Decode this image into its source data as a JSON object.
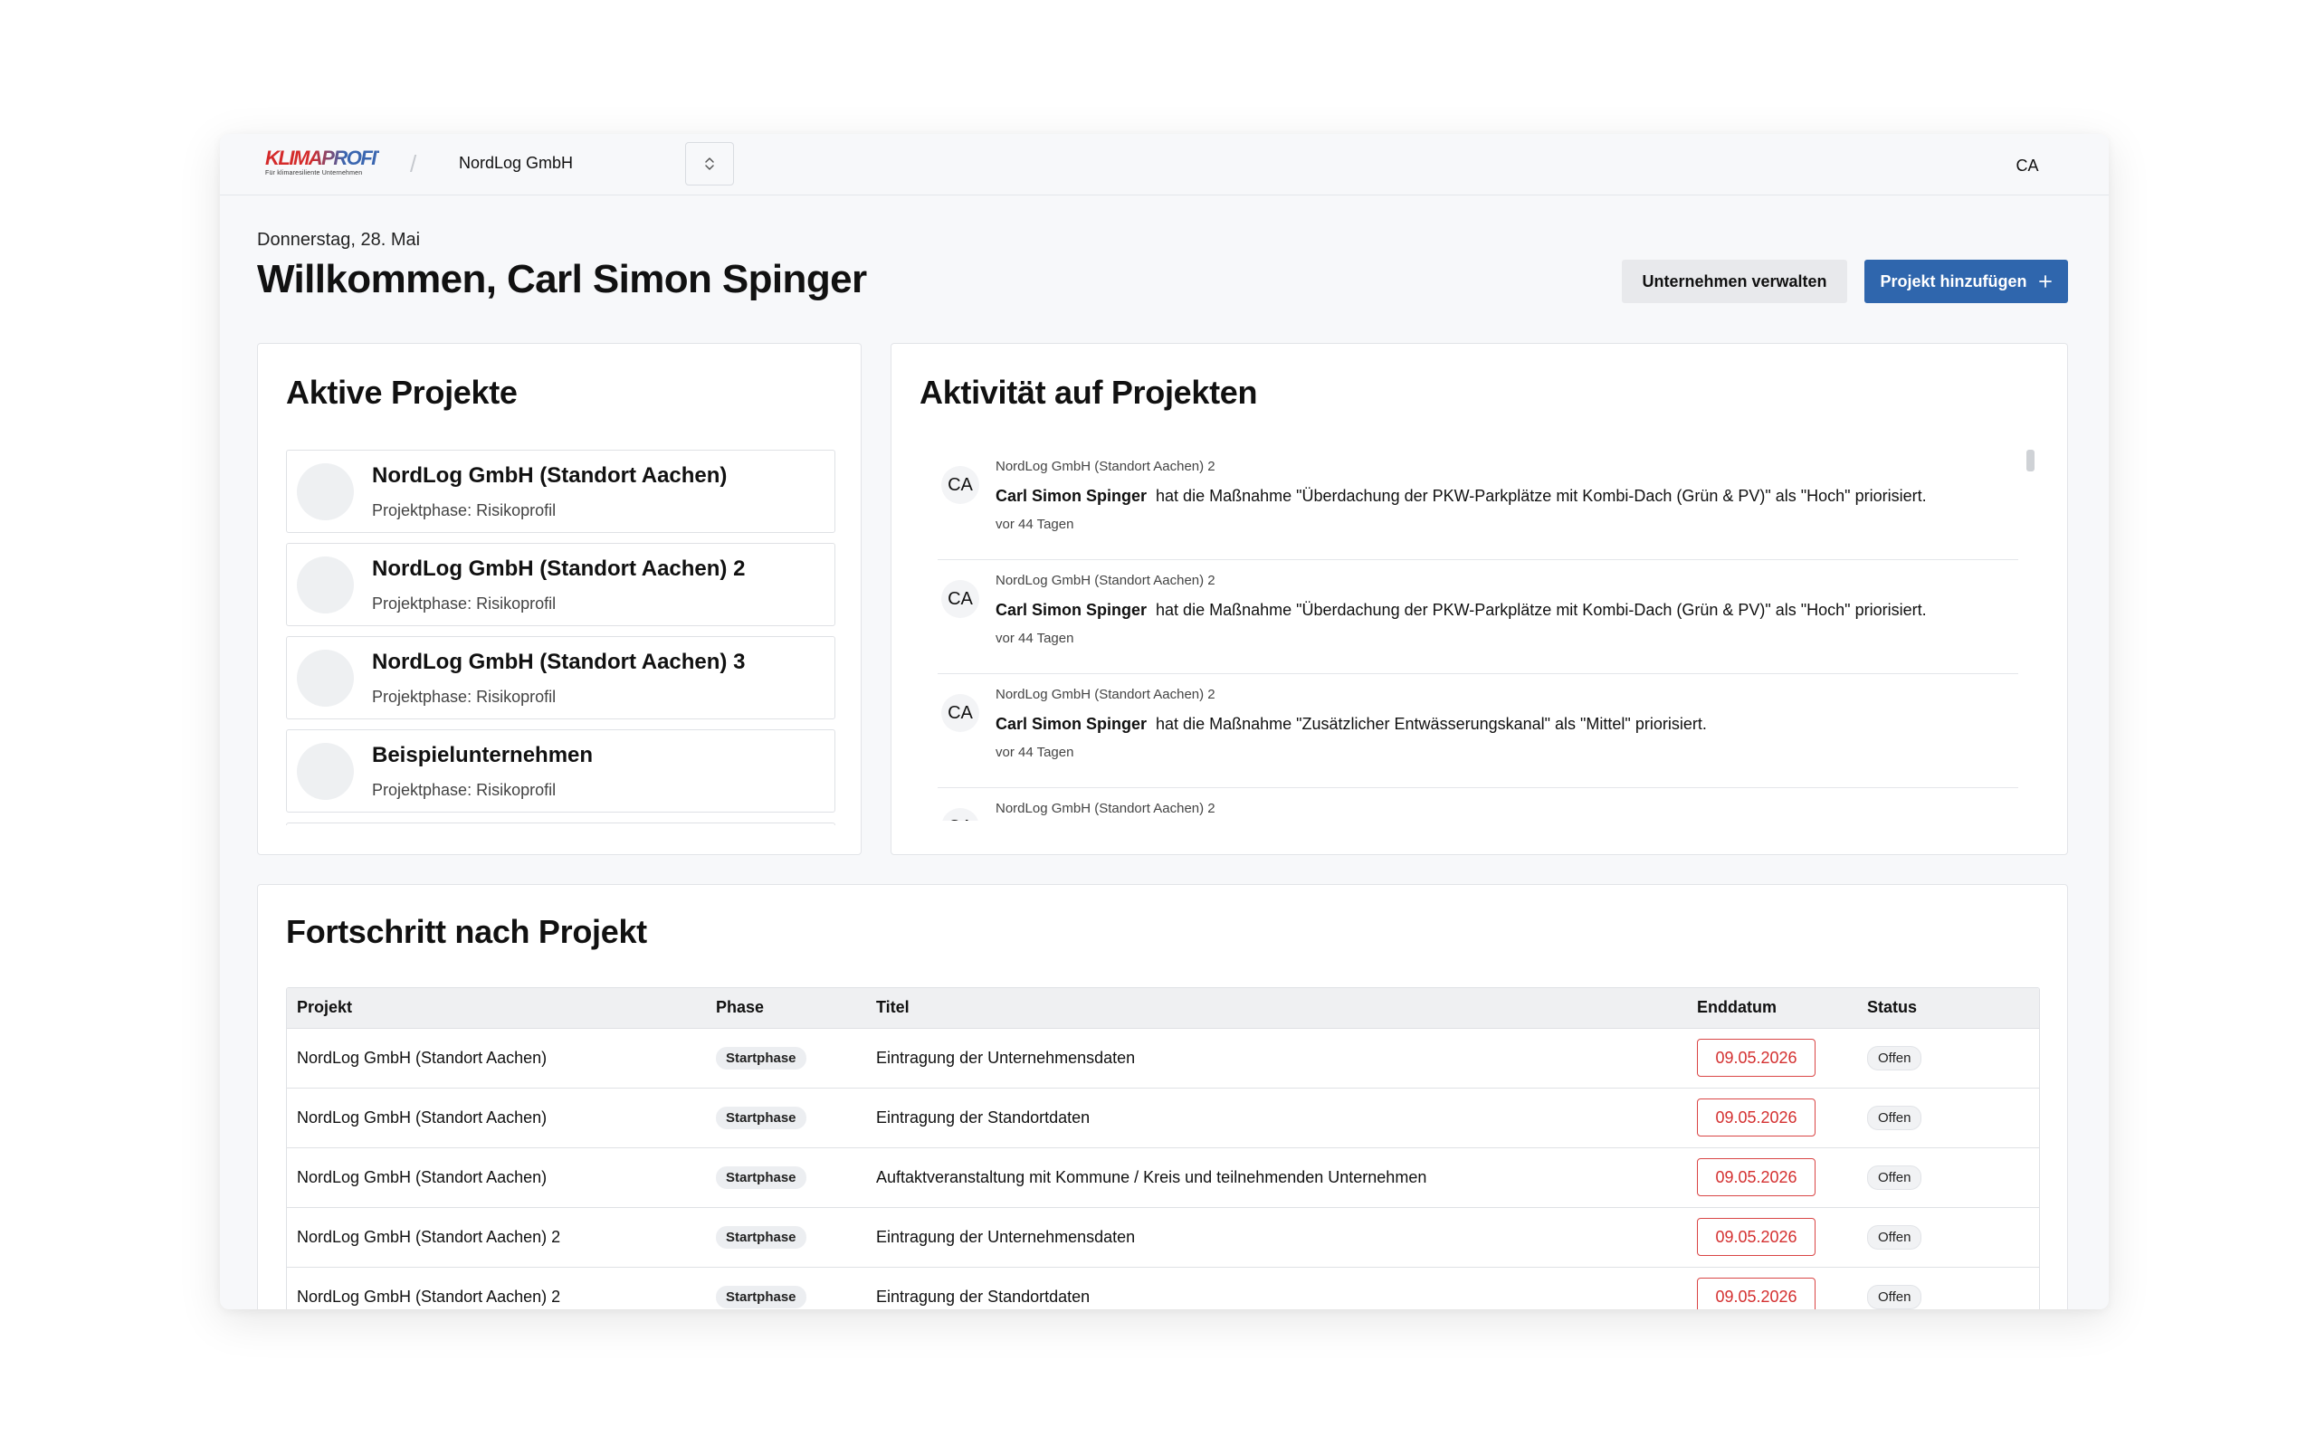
{
  "topbar": {
    "logo_text": "KLIMAPROFIT",
    "logo_tagline": "Für klimaresiliente Unternehmen",
    "separator": "/",
    "company": "NordLog GmbH",
    "user_initials": "CA"
  },
  "header": {
    "date": "Donnerstag, 28. Mai",
    "welcome": "Willkommen, Carl Simon Spinger",
    "manage_button": "Unternehmen verwalten",
    "add_project_button": "Projekt hinzufügen",
    "add_icon": "plus-icon"
  },
  "projects": {
    "title": "Aktive Projekte",
    "items": [
      {
        "name": "NordLog GmbH (Standort Aachen)",
        "phase": "Projektphase: Risikoprofil"
      },
      {
        "name": "NordLog GmbH (Standort Aachen) 2",
        "phase": "Projektphase: Risikoprofil"
      },
      {
        "name": "NordLog GmbH (Standort Aachen) 3",
        "phase": "Projektphase: Risikoprofil"
      },
      {
        "name": "Beispielunternehmen",
        "phase": "Projektphase: Risikoprofil"
      }
    ]
  },
  "activity": {
    "title": "Aktivität auf Projekten",
    "items": [
      {
        "initials": "CA",
        "project": "NordLog GmbH (Standort Aachen) 2",
        "user": "Carl Simon Spinger",
        "text": "hat die Maßnahme \"Überdachung der PKW-Parkplätze mit Kombi-Dach (Grün & PV)\" als \"Hoch\" priorisiert.",
        "time": "vor 44 Tagen"
      },
      {
        "initials": "CA",
        "project": "NordLog GmbH (Standort Aachen) 2",
        "user": "Carl Simon Spinger",
        "text": "hat die Maßnahme \"Überdachung der PKW-Parkplätze mit Kombi-Dach (Grün & PV)\" als \"Hoch\" priorisiert.",
        "time": "vor 44 Tagen"
      },
      {
        "initials": "CA",
        "project": "NordLog GmbH (Standort Aachen) 2",
        "user": "Carl Simon Spinger",
        "text": "hat die Maßnahme \"Zusätzlicher Entwässerungskanal\" als \"Mittel\" priorisiert.",
        "time": "vor 44 Tagen"
      },
      {
        "initials": "CA",
        "project": "NordLog GmbH (Standort Aachen) 2",
        "user": "",
        "text": "",
        "time": ""
      }
    ]
  },
  "progress": {
    "title": "Fortschritt nach Projekt",
    "columns": [
      "Projekt",
      "Phase",
      "Titel",
      "Enddatum",
      "Status"
    ],
    "rows": [
      {
        "project": "NordLog GmbH (Standort Aachen)",
        "phase": "Startphase",
        "title": "Eintragung der Unternehmensdaten",
        "end": "09.05.2026",
        "status": "Offen"
      },
      {
        "project": "NordLog GmbH (Standort Aachen)",
        "phase": "Startphase",
        "title": "Eintragung der Standortdaten",
        "end": "09.05.2026",
        "status": "Offen"
      },
      {
        "project": "NordLog GmbH (Standort Aachen)",
        "phase": "Startphase",
        "title": "Auftaktveranstaltung mit Kommune / Kreis und teilnehmenden Unternehmen",
        "end": "09.05.2026",
        "status": "Offen"
      },
      {
        "project": "NordLog GmbH (Standort Aachen) 2",
        "phase": "Startphase",
        "title": "Eintragung der Unternehmensdaten",
        "end": "09.05.2026",
        "status": "Offen"
      },
      {
        "project": "NordLog GmbH (Standort Aachen) 2",
        "phase": "Startphase",
        "title": "Eintragung der Standortdaten",
        "end": "09.05.2026",
        "status": "Offen"
      }
    ]
  },
  "colors": {
    "primary": "#2f66ad",
    "overdue": "#d43030",
    "logo_red": "#d42a2a",
    "logo_blue": "#3a66b0"
  }
}
